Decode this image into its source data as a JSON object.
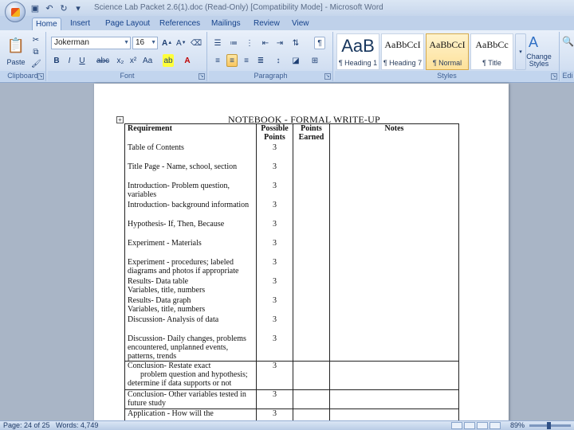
{
  "window": {
    "title": "Science Lab Packet 2.6(1).doc (Read-Only) [Compatibility Mode] - Microsoft Word",
    "qat_icons": [
      "save-icon",
      "undo-icon",
      "redo-icon",
      "customize-icon"
    ]
  },
  "tabs": [
    {
      "label": "Home",
      "active": true
    },
    {
      "label": "Insert"
    },
    {
      "label": "Page Layout"
    },
    {
      "label": "References"
    },
    {
      "label": "Mailings"
    },
    {
      "label": "Review"
    },
    {
      "label": "View"
    }
  ],
  "ribbon": {
    "clipboard": {
      "label": "Clipboard",
      "paste": "Paste"
    },
    "font": {
      "label": "Font",
      "name": "Jokerman",
      "size": "16"
    },
    "paragraph": {
      "label": "Paragraph"
    },
    "styles": {
      "label": "Styles",
      "items": [
        {
          "sample": "AaB",
          "name": "¶ Heading 1"
        },
        {
          "sample": "AaBbCcI",
          "name": "¶ Heading 7"
        },
        {
          "sample": "AaBbCcI",
          "name": "¶ Normal"
        },
        {
          "sample": "AaBbCc",
          "name": "¶ Title"
        }
      ],
      "change": "Change Styles"
    },
    "editing": {
      "label": "Edi"
    }
  },
  "document": {
    "heading": "NOTEBOOK - FORMAL WRITE-UP",
    "table": {
      "headers": [
        "Requirement",
        "Possible Points",
        "Points Earned",
        "Notes"
      ],
      "rows": [
        {
          "req": "Table of Contents",
          "pts": "3"
        },
        {
          "req": "Title Page - Name, school, section",
          "pts": "3"
        },
        {
          "req": "Introduction- Problem question, variables",
          "pts": "3"
        },
        {
          "req": "Introduction- background information",
          "pts": "3"
        },
        {
          "req": "Hypothesis- If, Then, Because",
          "pts": "3"
        },
        {
          "req": "Experiment - Materials",
          "pts": "3"
        },
        {
          "req": "Experiment - procedures; labeled diagrams and photos if appropriate",
          "pts": "3"
        },
        {
          "req": "Results- Data table",
          "req2": "Variables, title, numbers",
          "pts": "3"
        },
        {
          "req": "Results- Data graph",
          "req2": "Variables, title, numbers",
          "pts": "3"
        },
        {
          "req": "Discussion- Analysis of data",
          "pts": "3"
        },
        {
          "req": "Discussion- Daily changes, problems encountered, unplanned events, patterns, trends",
          "pts": "3"
        },
        {
          "req": "Conclusion- Restate exact",
          "req2": "problem question and hypothesis;",
          "req3": "determine if data supports or not",
          "pts": "3"
        },
        {
          "req": "Conclusion- Other variables tested in future study",
          "pts": "3"
        },
        {
          "req": "Application - How will the",
          "pts": "3"
        }
      ]
    }
  },
  "status": {
    "page": "Page: 24 of 25",
    "words": "Words: 4,749",
    "zoom": "89%"
  }
}
